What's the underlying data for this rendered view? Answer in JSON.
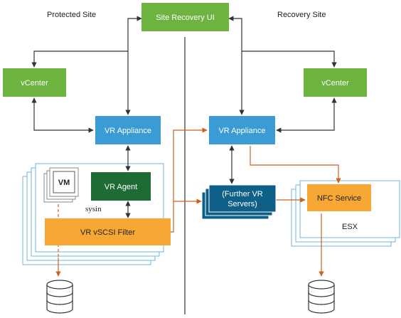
{
  "site_labels": {
    "protected": "Protected Site",
    "recovery": "Recovery Site"
  },
  "boxes": {
    "site_recovery_ui": "Site Recovery UI",
    "vcenter_left": "vCenter",
    "vcenter_right": "vCenter",
    "vr_appliance_left": "VR Appliance",
    "vr_appliance_right": "VR Appliance",
    "vr_agent": "VR Agent",
    "vm": "VM",
    "sysin": "sysin",
    "vr_vscsi_filter": "VR vSCSI Filter",
    "further_vr_servers_line1": "(Further VR",
    "further_vr_servers_line2": "Servers)",
    "nfc_service": "NFC Service",
    "esx": "ESX"
  },
  "colors": {
    "green": "#6db33f",
    "dark_green": "#1e6b35",
    "blue": "#3a9bd5",
    "dark_blue": "#0f6088",
    "orange": "#f7a734",
    "orange_line": "#d2601a",
    "host_border": "#6cb4e0",
    "arrow_dark": "#333333"
  }
}
